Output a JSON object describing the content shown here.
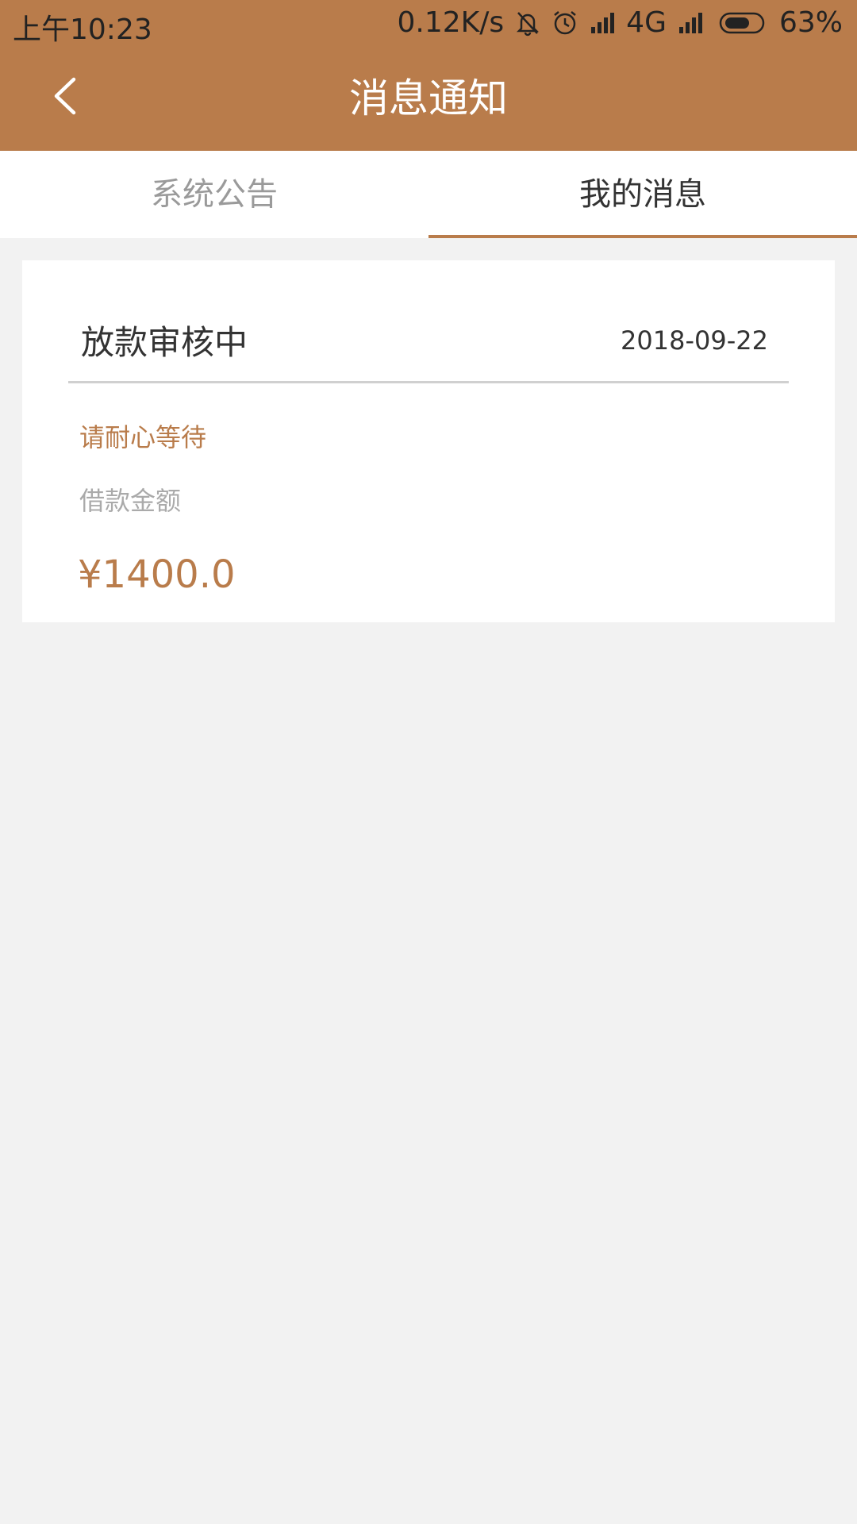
{
  "status_bar": {
    "time": "上午10:23",
    "network_speed": "0.12K/s",
    "network_type": "4G",
    "battery": "63%",
    "icons": [
      "bell-muted-icon",
      "alarm-icon",
      "signal-icon",
      "signal-icon"
    ]
  },
  "header": {
    "title": "消息通知",
    "back_icon": "chevron-left-icon"
  },
  "tabs": [
    {
      "label": "系统公告",
      "active": false
    },
    {
      "label": "我的消息",
      "active": true
    }
  ],
  "messages": [
    {
      "title": "放款审核中",
      "date": "2018-09-22",
      "status": "请耐心等待",
      "amount_label": "借款金额",
      "amount": "¥1400.0"
    }
  ],
  "colors": {
    "brand": "#b97c4b",
    "background": "#f2f2f2",
    "text_primary": "#333333",
    "text_muted": "#9a9a9a"
  }
}
